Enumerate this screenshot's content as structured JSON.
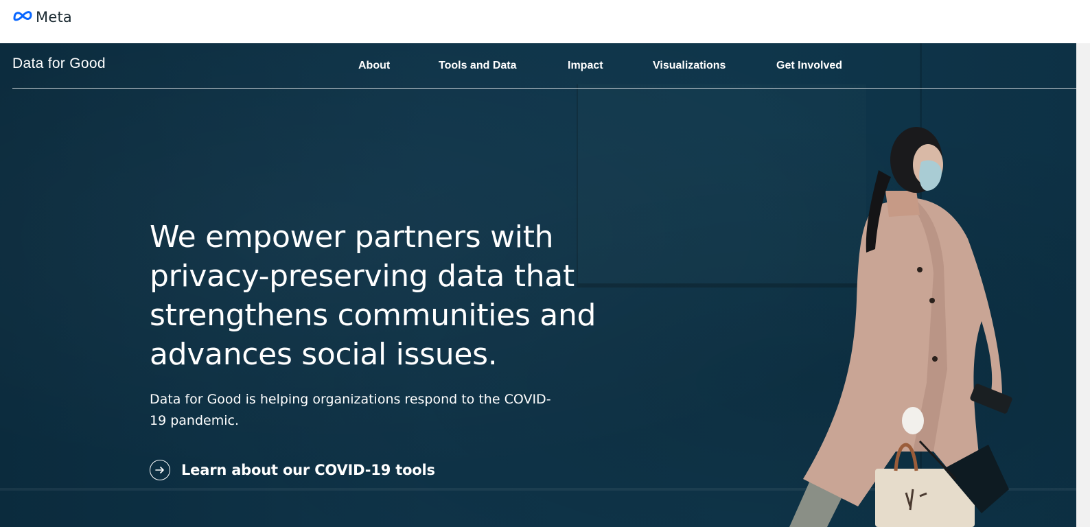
{
  "meta_bar": {
    "logo_text": "Meta",
    "logo_icon": "meta-infinity-icon",
    "brand_color": "#0866ff"
  },
  "site": {
    "brand": "Data for Good"
  },
  "nav": {
    "items": [
      {
        "label": "About"
      },
      {
        "label": "Tools and Data"
      },
      {
        "label": "Impact"
      },
      {
        "label": "Visualizations"
      },
      {
        "label": "Get Involved"
      }
    ]
  },
  "hero": {
    "headline": "We empower partners with privacy-preserving data that strengthens communities and advances social issues.",
    "subtext": "Data for Good is helping organizations respond to the COVID-19 pandemic.",
    "cta_label": "Learn about our COVID-19 tools",
    "cta_icon": "arrow-right-circle-icon",
    "background_color": "#0f3449",
    "text_color": "#ffffff"
  }
}
